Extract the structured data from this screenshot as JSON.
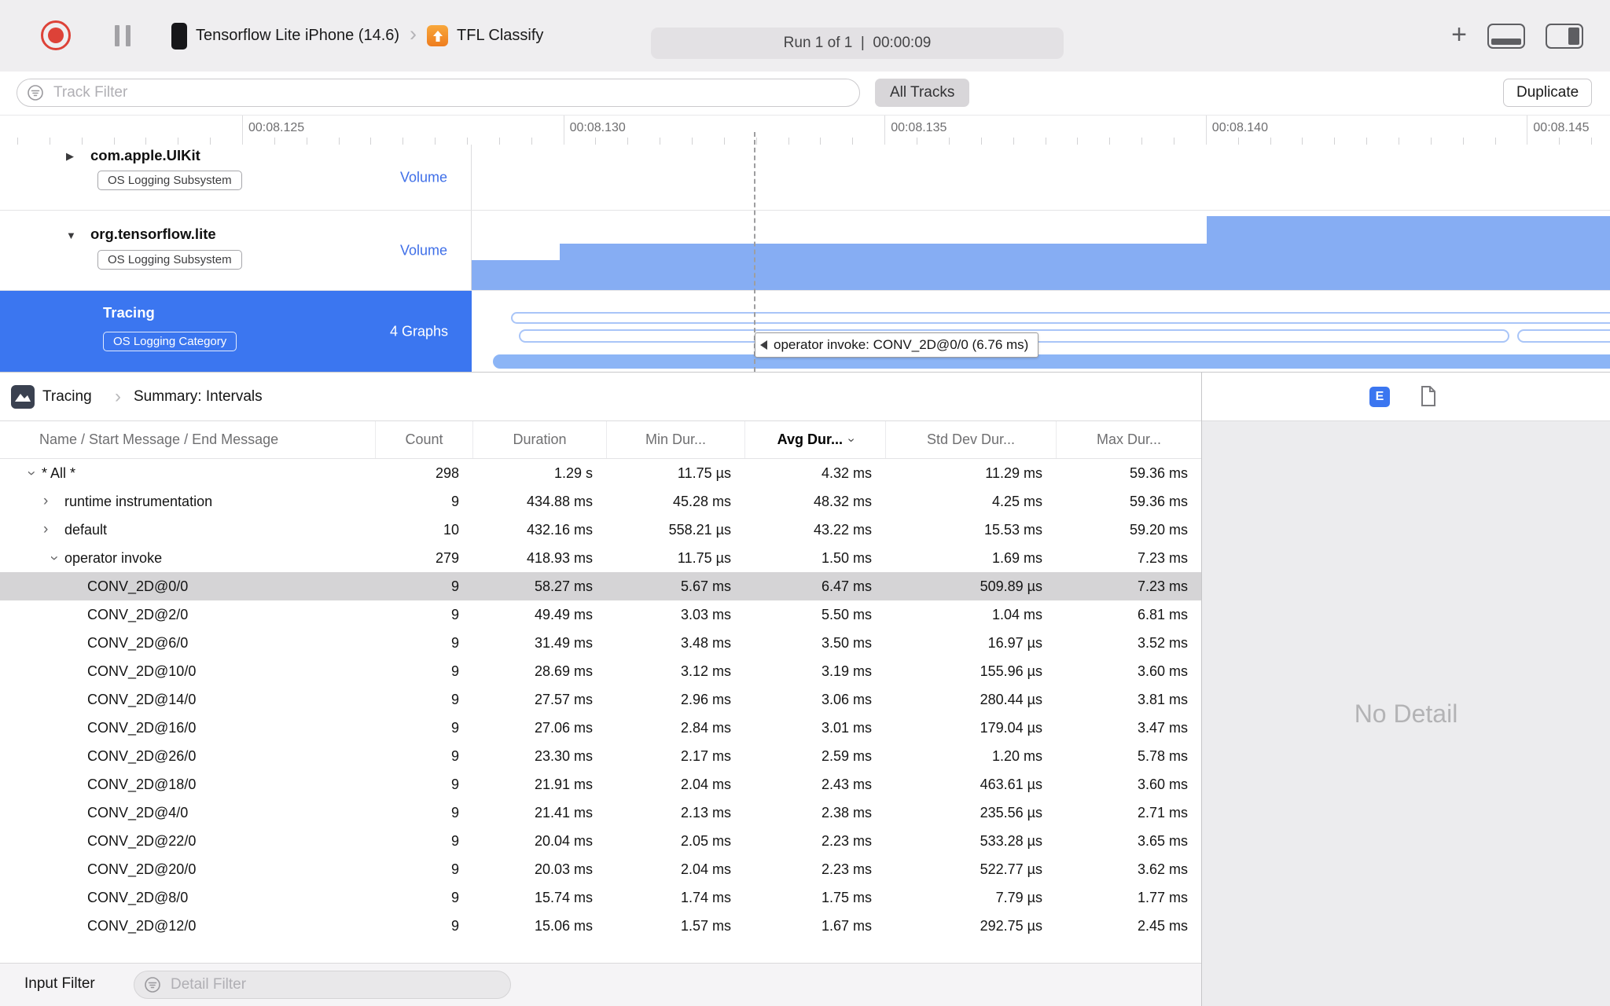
{
  "toolbar": {
    "device_name": "Tensorflow Lite iPhone (14.6)",
    "app_name": "TFL Classify",
    "run_status": "Run 1 of 1  |  00:00:09"
  },
  "filter_bar": {
    "track_filter_placeholder": "Track Filter",
    "all_tracks_label": "All Tracks",
    "duplicate_label": "Duplicate"
  },
  "timeline": {
    "tick_labels": [
      "00:08.125",
      "00:08.130",
      "00:08.135",
      "00:08.140",
      "00:08.145"
    ],
    "tooltip": "operator invoke: CONV_2D@0/0 (6.76 ms)"
  },
  "tracks": [
    {
      "name": "com.apple.UIKit",
      "badge": "OS Logging Subsystem",
      "meta": "Volume",
      "disclosure": "collapsed"
    },
    {
      "name": "org.tensorflow.lite",
      "badge": "OS Logging Subsystem",
      "meta": "Volume",
      "disclosure": "expanded"
    },
    {
      "name": "Tracing",
      "badge": "OS Logging Category",
      "meta": "4 Graphs",
      "selected": true
    }
  ],
  "detail": {
    "breadcrumb": {
      "root": "Tracing",
      "page": "Summary: Intervals"
    },
    "expanded_detail_button": "E",
    "columns": [
      "Name / Start Message / End Message",
      "Count",
      "Duration",
      "Min Dur...",
      "Avg Dur...",
      "Std Dev Dur...",
      "Max Dur..."
    ],
    "sorted_column": "Avg Dur...",
    "rows": [
      {
        "name": "* All *",
        "level": 0,
        "disclosure": "expanded",
        "count": "298",
        "duration": "1.29 s",
        "min": "11.75 µs",
        "avg": "4.32 ms",
        "std": "11.29 ms",
        "max": "59.36 ms",
        "selected": false
      },
      {
        "name": "runtime instrumentation",
        "level": 1,
        "disclosure": "collapsed",
        "count": "9",
        "duration": "434.88 ms",
        "min": "45.28 ms",
        "avg": "48.32 ms",
        "std": "4.25 ms",
        "max": "59.36 ms",
        "selected": false
      },
      {
        "name": "default",
        "level": 1,
        "disclosure": "collapsed",
        "count": "10",
        "duration": "432.16 ms",
        "min": "558.21 µs",
        "avg": "43.22 ms",
        "std": "15.53 ms",
        "max": "59.20 ms",
        "selected": false
      },
      {
        "name": "operator invoke",
        "level": 1,
        "disclosure": "expanded",
        "count": "279",
        "duration": "418.93 ms",
        "min": "11.75 µs",
        "avg": "1.50 ms",
        "std": "1.69 ms",
        "max": "7.23 ms",
        "selected": false
      },
      {
        "name": "CONV_2D@0/0",
        "level": 2,
        "disclosure": null,
        "count": "9",
        "duration": "58.27 ms",
        "min": "5.67 ms",
        "avg": "6.47 ms",
        "std": "509.89 µs",
        "max": "7.23 ms",
        "selected": true
      },
      {
        "name": "CONV_2D@2/0",
        "level": 2,
        "disclosure": null,
        "count": "9",
        "duration": "49.49 ms",
        "min": "3.03 ms",
        "avg": "5.50 ms",
        "std": "1.04 ms",
        "max": "6.81 ms",
        "selected": false
      },
      {
        "name": "CONV_2D@6/0",
        "level": 2,
        "disclosure": null,
        "count": "9",
        "duration": "31.49 ms",
        "min": "3.48 ms",
        "avg": "3.50 ms",
        "std": "16.97 µs",
        "max": "3.52 ms",
        "selected": false
      },
      {
        "name": "CONV_2D@10/0",
        "level": 2,
        "disclosure": null,
        "count": "9",
        "duration": "28.69 ms",
        "min": "3.12 ms",
        "avg": "3.19 ms",
        "std": "155.96 µs",
        "max": "3.60 ms",
        "selected": false
      },
      {
        "name": "CONV_2D@14/0",
        "level": 2,
        "disclosure": null,
        "count": "9",
        "duration": "27.57 ms",
        "min": "2.96 ms",
        "avg": "3.06 ms",
        "std": "280.44 µs",
        "max": "3.81 ms",
        "selected": false
      },
      {
        "name": "CONV_2D@16/0",
        "level": 2,
        "disclosure": null,
        "count": "9",
        "duration": "27.06 ms",
        "min": "2.84 ms",
        "avg": "3.01 ms",
        "std": "179.04 µs",
        "max": "3.47 ms",
        "selected": false
      },
      {
        "name": "CONV_2D@26/0",
        "level": 2,
        "disclosure": null,
        "count": "9",
        "duration": "23.30 ms",
        "min": "2.17 ms",
        "avg": "2.59 ms",
        "std": "1.20 ms",
        "max": "5.78 ms",
        "selected": false
      },
      {
        "name": "CONV_2D@18/0",
        "level": 2,
        "disclosure": null,
        "count": "9",
        "duration": "21.91 ms",
        "min": "2.04 ms",
        "avg": "2.43 ms",
        "std": "463.61 µs",
        "max": "3.60 ms",
        "selected": false
      },
      {
        "name": "CONV_2D@4/0",
        "level": 2,
        "disclosure": null,
        "count": "9",
        "duration": "21.41 ms",
        "min": "2.13 ms",
        "avg": "2.38 ms",
        "std": "235.56 µs",
        "max": "2.71 ms",
        "selected": false
      },
      {
        "name": "CONV_2D@22/0",
        "level": 2,
        "disclosure": null,
        "count": "9",
        "duration": "20.04 ms",
        "min": "2.05 ms",
        "avg": "2.23 ms",
        "std": "533.28 µs",
        "max": "3.65 ms",
        "selected": false
      },
      {
        "name": "CONV_2D@20/0",
        "level": 2,
        "disclosure": null,
        "count": "9",
        "duration": "20.03 ms",
        "min": "2.04 ms",
        "avg": "2.23 ms",
        "std": "522.77 µs",
        "max": "3.62 ms",
        "selected": false
      },
      {
        "name": "CONV_2D@8/0",
        "level": 2,
        "disclosure": null,
        "count": "9",
        "duration": "15.74 ms",
        "min": "1.74 ms",
        "avg": "1.75 ms",
        "std": "7.79 µs",
        "max": "1.77 ms",
        "selected": false
      },
      {
        "name": "CONV_2D@12/0",
        "level": 2,
        "disclosure": null,
        "count": "9",
        "duration": "15.06 ms",
        "min": "1.57 ms",
        "avg": "1.67 ms",
        "std": "292.75 µs",
        "max": "2.45 ms",
        "selected": false
      }
    ],
    "no_detail": "No Detail"
  },
  "bottom_bar": {
    "input_filter_label": "Input Filter",
    "detail_filter_placeholder": "Detail Filter"
  },
  "colors": {
    "accent_blue": "#3B76F0",
    "volume_fill": "#86ADF3",
    "capsule_stroke": "#A9C5F8",
    "selected_row_gray": "#D5D4D6",
    "record_red": "#DD4238"
  },
  "icons": {
    "record-icon": "red ring with filled dot",
    "pause-icon": "two vertical bars",
    "iphone-icon": "black rounded rectangle",
    "tfl-app-icon": "orange rounded square with up arrow",
    "add-icon": "+",
    "layout-bottom-icon": "rect with filled bottom strip",
    "layout-right-icon": "rect with filled right strip",
    "filter-icon": "circle with three lines",
    "chevron-right-icon": "›",
    "disclosure-collapsed-icon": "▶ / ›",
    "disclosure-expanded-icon": "▼ / ⌄",
    "tracing-instrument-icon": "dark square with white mountain",
    "expanded-detail-icon": "blue square with E",
    "document-icon": "page outline with folded corner",
    "tooltip-arrow-icon": "left-pointing triangle"
  }
}
